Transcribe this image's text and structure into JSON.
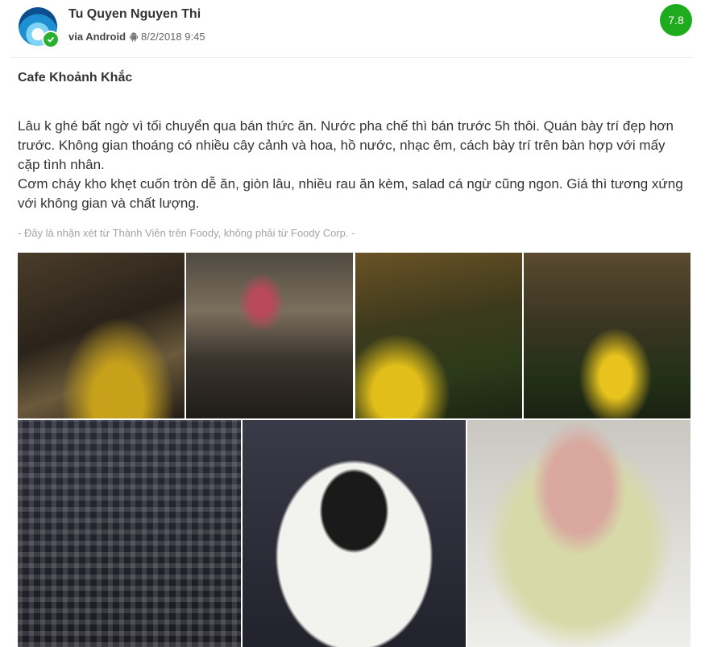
{
  "header": {
    "user_name": "Tu Quyen Nguyen Thi",
    "via": "via Android",
    "timestamp": "8/2/2018 9:45",
    "score": "7.8",
    "avatar_icon": "avatar-globe-icon",
    "verified_icon": "check-icon",
    "device_icon": "android-icon"
  },
  "review": {
    "title": "Cafe Khoảnh Khắc",
    "paragraphs": [
      "Lâu k ghé bất ngờ vì tối chuyển qua bán thức ăn. Nước pha chế thì bán trước 5h thôi. Quán bày trí đẹp hơn trước. Không gian thoáng có nhiều cây cảnh và hoa, hồ nước, nhạc êm, cách bày trí trên bàn hợp với mấy cặp tình nhân.",
      "Cơm cháy kho khẹt cuốn tròn dễ ăn, giòn lâu, nhiều rau ăn kèm, salad cá ngừ cũng ngon. Giá thì tương xứng với không gian và chất lượng."
    ],
    "disclaimer": "- Đây là nhận xét từ Thành Viên trên Foody, không phải từ Foody Corp. -"
  },
  "photos": [
    {
      "name": "photo-cafe-entrance"
    },
    {
      "name": "photo-cafe-interior-flowers"
    },
    {
      "name": "photo-cafe-garden-plants"
    },
    {
      "name": "photo-cafe-garden-lights"
    },
    {
      "name": "photo-table-setting"
    },
    {
      "name": "photo-com-chay-kho-quet"
    },
    {
      "name": "photo-tuna-salad"
    }
  ],
  "colors": {
    "score_badge": "#1eab1e",
    "verified_badge": "#2ab02f",
    "disclaimer_text": "#a3a3a3"
  }
}
